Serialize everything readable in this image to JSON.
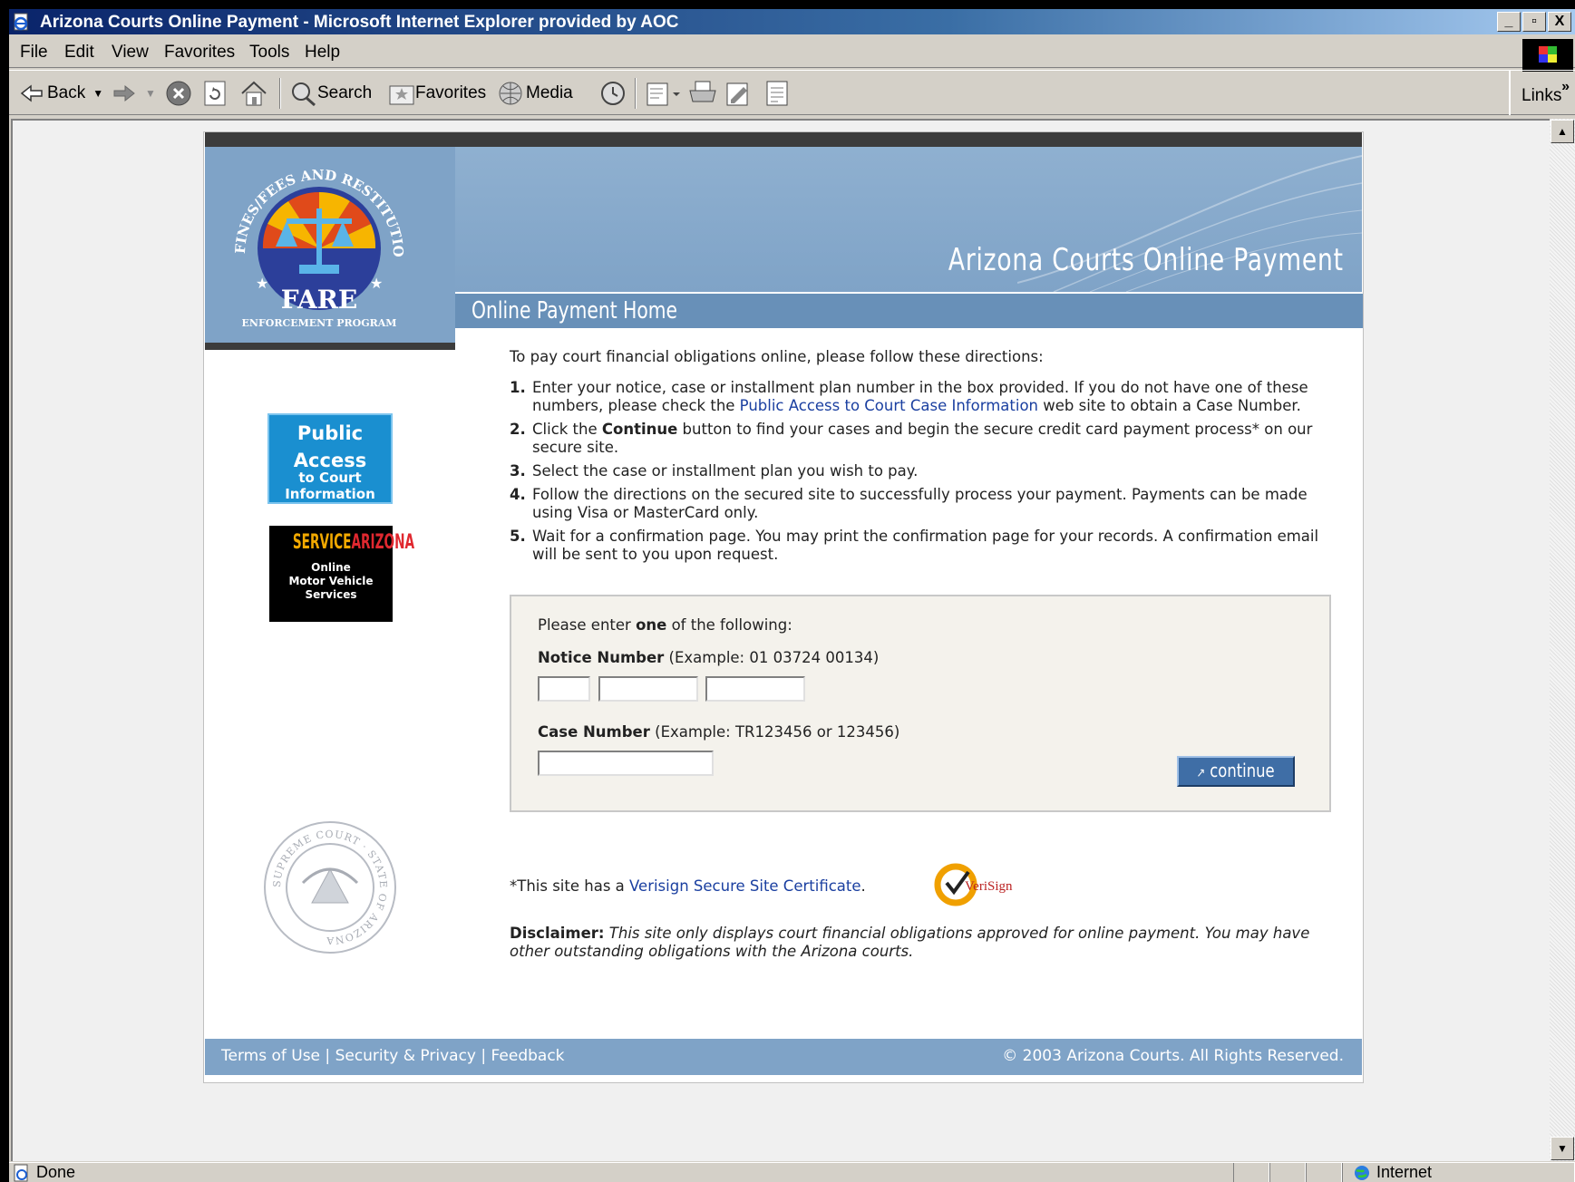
{
  "window": {
    "title": "Arizona Courts Online Payment - Microsoft Internet Explorer provided by AOC",
    "controls": [
      "_",
      "▫",
      "X"
    ]
  },
  "menubar": [
    "File",
    "Edit",
    "View",
    "Favorites",
    "Tools",
    "Help"
  ],
  "toolbar": {
    "back": "Back",
    "search": "Search",
    "favorites": "Favorites",
    "media": "Media",
    "links": "Links"
  },
  "status": {
    "text": "Done",
    "zone": "Internet"
  },
  "page": {
    "site_title": "Arizona Courts Online Payment",
    "section_title": "Online Payment Home",
    "logo": {
      "arc_text": "FINES/FEES AND RESTITUTION",
      "name": "FARE",
      "subtitle": "ENFORCEMENT PROGRAM"
    },
    "public_access_button": [
      "Public",
      "Access",
      "to Court",
      "Information"
    ],
    "service_arizona": {
      "brand_a": "SERVICE",
      "brand_b": "ARIZONA",
      "lines": [
        "Online",
        "Motor Vehicle",
        "Services"
      ]
    },
    "seal_text": "SUPREME COURT · STATE OF ARIZONA",
    "intro": "To pay court financial obligations online, please follow these directions:",
    "steps": [
      {
        "num": "1.",
        "before": "Enter your notice, case or installment plan number in the box provided. If you do not have one of these numbers, please check the ",
        "link": "Public Access to Court Case Information",
        "after": " web site to obtain a Case Number."
      },
      {
        "num": "2.",
        "before": "Click the ",
        "bold": "Continue",
        "after": " button to find your cases and begin the secure credit card payment process* on our secure site."
      },
      {
        "num": "3.",
        "text": "Select the case or installment plan you wish to pay."
      },
      {
        "num": "4.",
        "text": "Follow the directions on the secured site to successfully process your payment. Payments can be made using Visa or MasterCard only."
      },
      {
        "num": "5.",
        "text": "Wait for a confirmation page. You may print the confirmation page for your records. A confirmation email will be sent to you upon request."
      }
    ],
    "form": {
      "prompt_before": "Please enter ",
      "prompt_bold": "one",
      "prompt_after": " of the following:",
      "notice_label": "Notice Number",
      "notice_example": " (Example: 01 03724 00134)",
      "notice_values": [
        "",
        "",
        ""
      ],
      "case_label": "Case Number",
      "case_example": " (Example: TR123456 or 123456)",
      "case_value": "",
      "continue_button": "continue"
    },
    "certificate": {
      "before": "*This site has a ",
      "link": "Verisign Secure Site Certificate",
      "after": ".",
      "badge": "VeriSign"
    },
    "disclaimer": {
      "label": "Disclaimer:",
      "text": " This site only displays court financial obligations approved for online payment. You may have other outstanding obligations with the Arizona courts."
    },
    "footer": {
      "links": [
        "Terms of Use",
        "Security & Privacy",
        "Feedback"
      ],
      "separator": " | ",
      "copyright": "© 2003 Arizona Courts. All Rights Reserved."
    }
  },
  "colors": {
    "banner": "#7fa3c7",
    "section_bar": "#6890b8",
    "link": "#1a3fa0",
    "titlebar": "#0a246a"
  }
}
